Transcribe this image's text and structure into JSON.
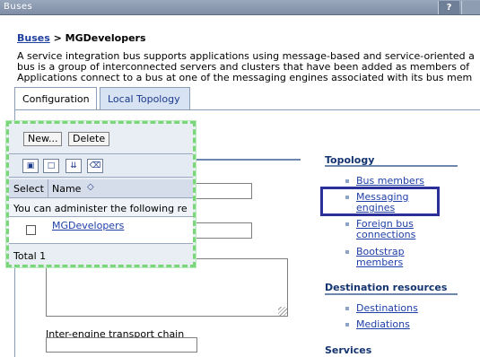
{
  "window": {
    "title": "Buses",
    "help_label": "?"
  },
  "breadcrumb": {
    "link": "Buses",
    "separator": " > ",
    "current": "MGDevelopers"
  },
  "description": {
    "line1": "A service integration bus supports applications using message-based and service-oriented a",
    "line2": "bus is a group of interconnected servers and clusters that have been added as members of",
    "line3": "Applications connect to a bus at one of the messaging engines associated with its bus mem"
  },
  "tabs": [
    {
      "label": "Configuration"
    },
    {
      "label": "Local Topology"
    }
  ],
  "form": {
    "transport_chain_label": "Inter-engine transport chain"
  },
  "popup": {
    "new_button": "New...",
    "delete_button": "Delete",
    "columns": {
      "select": "Select",
      "name": "Name"
    },
    "sort_icon": "◇",
    "admin_note": "You can administer the following re",
    "rows": [
      {
        "name": "MGDevelopers",
        "checked": false
      }
    ],
    "total": "Total 1",
    "toolbar_icons": [
      "select-all-icon",
      "deselect-all-icon",
      "expand-filter-icon",
      "clear-filter-icon"
    ]
  },
  "right": {
    "topology": {
      "heading": "Topology",
      "links": [
        {
          "text": "Bus members",
          "lines": [
            "Bus members"
          ]
        },
        {
          "text": "Messaging engines",
          "lines": [
            "Messaging",
            "engines"
          ]
        },
        {
          "text": "Foreign bus connections",
          "lines": [
            "Foreign bus",
            "connections"
          ]
        },
        {
          "text": "Bootstrap members",
          "lines": [
            "Bootstrap",
            "members"
          ]
        }
      ]
    },
    "destination_resources": {
      "heading": "Destination resources",
      "links": [
        {
          "text": "Destinations"
        },
        {
          "text": "Mediations"
        }
      ]
    },
    "services": {
      "heading": "Services"
    }
  },
  "colors": {
    "highlight_border": "#2a2f9a",
    "popup_border": "#7bd67b",
    "link": "#1f3fa8"
  }
}
